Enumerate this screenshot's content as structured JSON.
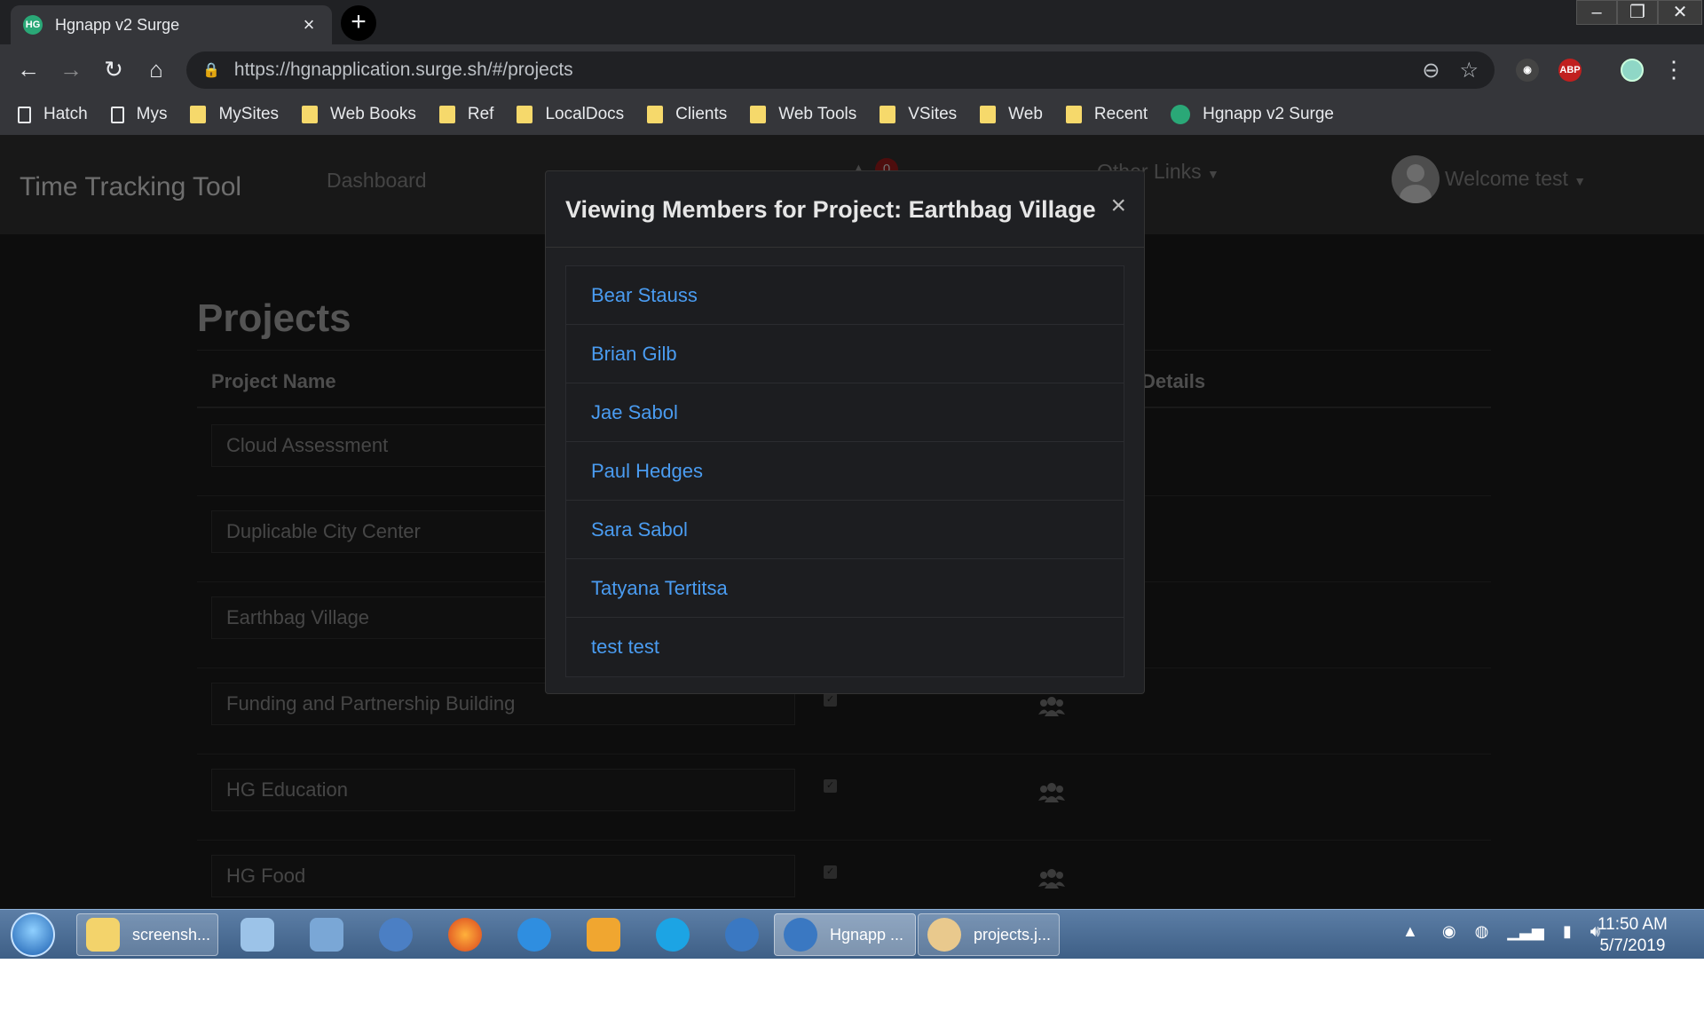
{
  "browser": {
    "tab_title": "Hgnapp v2 Surge",
    "tab_favicon_text": "HG",
    "url": "https://hgnapplication.surge.sh/#/projects",
    "bookmarks": [
      "Hatch",
      "Mys",
      "MySites",
      "Web Books",
      "Ref",
      "LocalDocs",
      "Clients",
      "Web Tools",
      "VSites",
      "Web",
      "Recent",
      "Hgnapp v2 Surge"
    ],
    "abp_label": "ABP"
  },
  "app": {
    "brand": "Time Tracking Tool",
    "nav": {
      "dashboard": "Dashboard",
      "other_links": "Other Links",
      "notif_count": "0",
      "welcome": "Welcome test"
    },
    "page_title": "Projects",
    "table": {
      "headers": {
        "name": "Project Name",
        "details": "Details"
      },
      "rows": [
        {
          "name": "Cloud Assessment"
        },
        {
          "name": "Duplicable City Center"
        },
        {
          "name": "Earthbag Village"
        },
        {
          "name": "Funding and Partnership Building"
        },
        {
          "name": "HG Education"
        },
        {
          "name": "HG Food"
        }
      ]
    }
  },
  "modal": {
    "title": "Viewing Members for Project: Earthbag Village",
    "close_label": "×",
    "members": [
      "Bear Stauss",
      "Brian Gilb",
      "Jae Sabol",
      "Paul Hedges",
      "Sara Sabol",
      "Tatyana Tertitsa",
      "test test"
    ]
  },
  "taskbar": {
    "items": [
      "screensh...",
      "Hgnapp ...",
      "projects.j..."
    ],
    "time": "11:50 AM",
    "date": "5/7/2019"
  },
  "colors": {
    "link": "#4a9cf1",
    "background": "#1b1b1b",
    "navbar": "#303030"
  }
}
